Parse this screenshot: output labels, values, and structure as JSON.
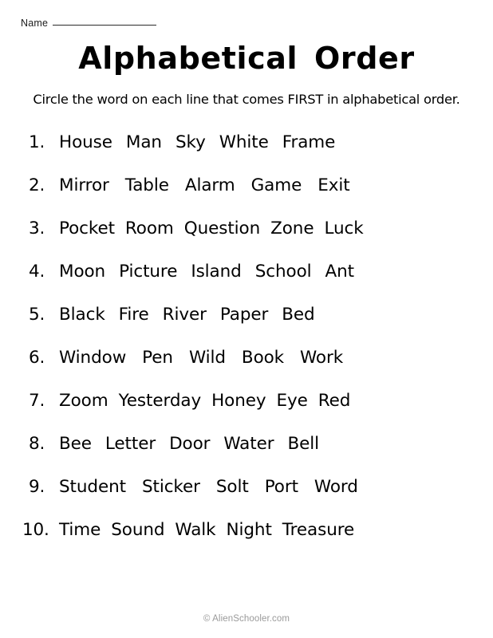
{
  "worksheet": {
    "name_field": {
      "label": "Name",
      "value": ""
    },
    "title": "Alphabetical Order",
    "instruction": "Circle the word on each line that comes FIRST in alphabetical order.",
    "footer": "© AlienSchooler.com",
    "questions": [
      {
        "number": "1.",
        "words": [
          "House",
          "Man",
          "Sky",
          "White",
          "Frame"
        ]
      },
      {
        "number": "2.",
        "words": [
          "Mirror",
          "Table",
          "Alarm",
          "Game",
          "Exit"
        ]
      },
      {
        "number": "3.",
        "words": [
          "Pocket",
          "Room",
          "Question",
          "Zone",
          "Luck"
        ]
      },
      {
        "number": "4.",
        "words": [
          "Moon",
          "Picture",
          "Island",
          "School",
          "Ant"
        ]
      },
      {
        "number": "5.",
        "words": [
          "Black",
          "Fire",
          "River",
          "Paper",
          "Bed"
        ]
      },
      {
        "number": "6.",
        "words": [
          "Window",
          "Pen",
          "Wild",
          "Book",
          "Work"
        ]
      },
      {
        "number": "7.",
        "words": [
          "Zoom",
          "Yesterday",
          "Honey",
          "Eye",
          "Red"
        ]
      },
      {
        "number": "8.",
        "words": [
          "Bee",
          "Letter",
          "Door",
          "Water",
          "Bell"
        ]
      },
      {
        "number": "9.",
        "words": [
          "Student",
          "Sticker",
          "Solt",
          "Port",
          "Word"
        ]
      },
      {
        "number": "10.",
        "words": [
          "Time",
          "Sound",
          "Walk",
          "Night",
          "Treasure"
        ]
      }
    ]
  }
}
